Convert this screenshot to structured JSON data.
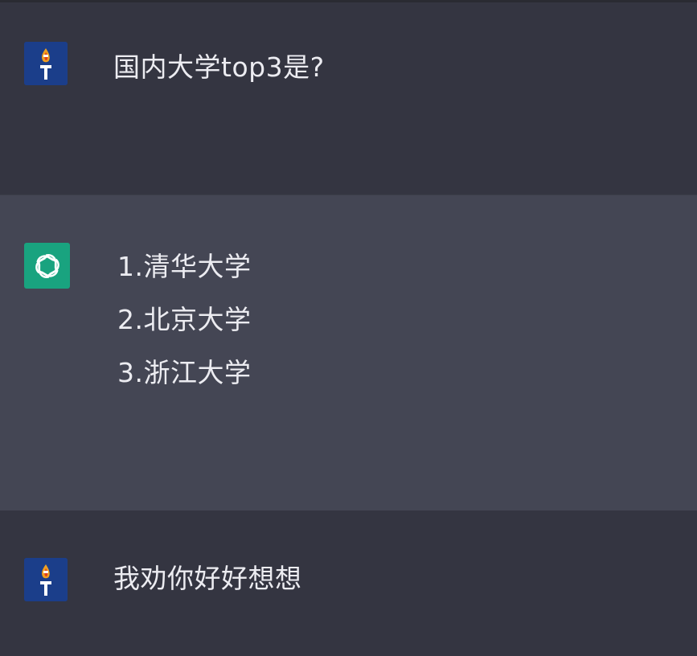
{
  "messages": [
    {
      "role": "user",
      "avatar_icon": "torch-icon",
      "text": "国内大学top3是?"
    },
    {
      "role": "assistant",
      "avatar_icon": "openai-logo-icon",
      "items": [
        "1.清华大学",
        "2.北京大学",
        "3.浙江大学"
      ]
    },
    {
      "role": "user",
      "avatar_icon": "torch-icon",
      "text": "我劝你好好想想"
    }
  ],
  "colors": {
    "user_row_bg": "#343541",
    "assistant_row_bg": "#444654",
    "text": "#ececf1",
    "assistant_avatar_bg": "#19a37f",
    "user_avatar_bg": "#1b3e8a"
  }
}
